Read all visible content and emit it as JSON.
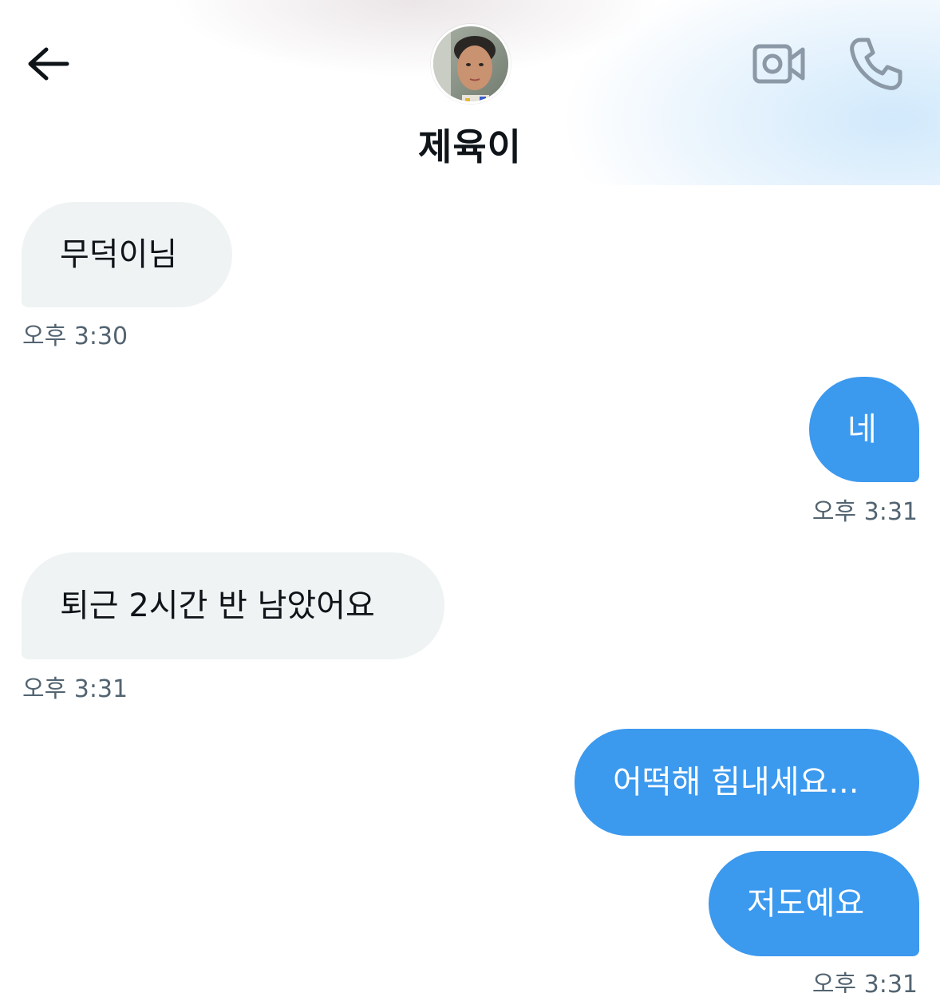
{
  "header": {
    "contact_name": "제육이",
    "icons": {
      "back": "arrow-left-icon",
      "video": "video-camera-icon",
      "call": "phone-icon"
    }
  },
  "messages": [
    {
      "direction": "incoming",
      "text": "무덕이님",
      "time": "오후 3:30"
    },
    {
      "direction": "outgoing",
      "text": "네",
      "time": "오후 3:31"
    },
    {
      "direction": "incoming",
      "text": "퇴근 2시간 반 남았어요",
      "time": "오후 3:31"
    },
    {
      "direction": "outgoing",
      "text": "어떡해 힘내세요...",
      "time": ""
    },
    {
      "direction": "outgoing",
      "text": "저도예요",
      "time": "오후 3:31"
    }
  ],
  "colors": {
    "outgoing_bubble": "#3b99ee",
    "incoming_bubble": "#eff3f4",
    "timestamp": "#536471",
    "text": "#0f1419"
  }
}
